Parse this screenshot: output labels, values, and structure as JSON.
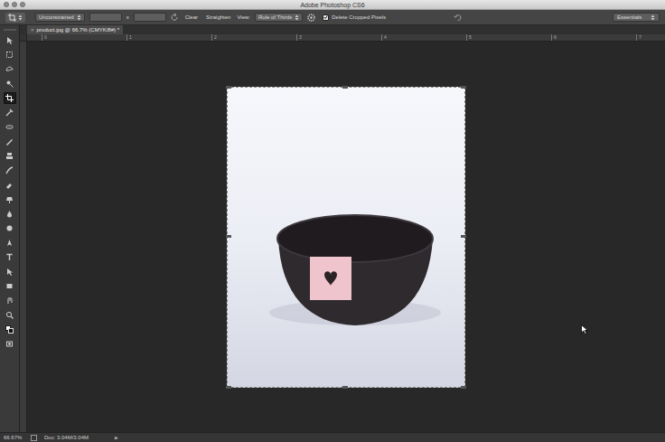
{
  "window": {
    "title": "Adobe Photoshop CS6"
  },
  "options_bar": {
    "ratio": "Unconstrained",
    "width": "",
    "height": "",
    "separator": "x",
    "clear": "Clear",
    "straighten": "Straighten",
    "view_label": "View:",
    "view": "Rule of Thirds",
    "delete_cropped": {
      "label": "Delete Cropped Pixels",
      "checked": true
    },
    "workspace": "Essentials"
  },
  "tools": [
    {
      "selected": false
    },
    {
      "selected": false
    },
    {
      "selected": false
    },
    {
      "selected": false
    },
    {
      "selected": true
    },
    {
      "selected": false
    },
    {
      "selected": false
    },
    {
      "selected": false
    },
    {
      "selected": false
    },
    {
      "selected": false
    },
    {
      "selected": false
    },
    {
      "selected": false
    },
    {
      "selected": false
    },
    {
      "selected": false
    },
    {
      "selected": false
    },
    {
      "selected": false
    },
    {
      "selected": false
    },
    {
      "selected": false
    },
    {
      "selected": false
    },
    {
      "selected": false
    },
    {
      "selected": false
    },
    {
      "selected": false
    }
  ],
  "document_tab": {
    "close": "×",
    "title": "product.jpg @ 66.7% (CMYK/8#) *"
  },
  "rulers": {
    "top": [
      "0",
      "1",
      "2",
      "3",
      "4",
      "5",
      "6",
      "7"
    ]
  },
  "status_bar": {
    "zoom": "66.67%",
    "doc": "Doc: 3.04M/3.04M",
    "arrow": "▶"
  }
}
